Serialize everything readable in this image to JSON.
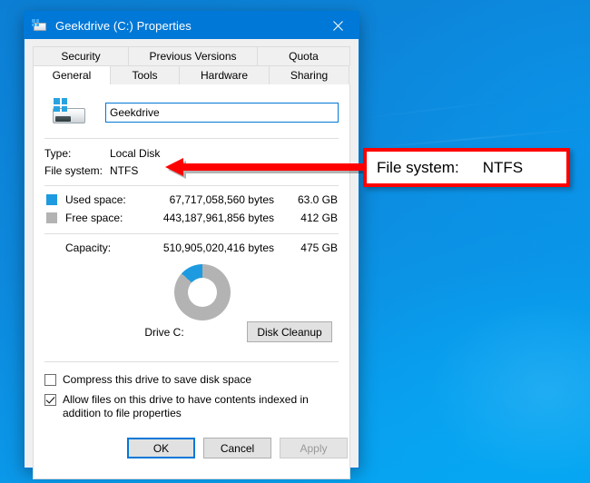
{
  "window": {
    "title": "Geekdrive (C:) Properties",
    "title_icon": "drive-icon",
    "close_label": "✕"
  },
  "tabs": {
    "row1": [
      {
        "label": "Security",
        "active": false
      },
      {
        "label": "Previous Versions",
        "active": false
      },
      {
        "label": "Quota",
        "active": false
      }
    ],
    "row2": [
      {
        "label": "General",
        "active": true
      },
      {
        "label": "Tools",
        "active": false
      },
      {
        "label": "Hardware",
        "active": false
      },
      {
        "label": "Sharing",
        "active": false
      }
    ]
  },
  "general": {
    "volume_name": "Geekdrive",
    "volume_name_placeholder": "",
    "info": [
      {
        "label": "Type:",
        "value": "Local Disk"
      },
      {
        "label": "File system:",
        "value": "NTFS"
      }
    ],
    "space": [
      {
        "swatch": "used",
        "label": "Used space:",
        "bytes": "67,717,058,560 bytes",
        "gb": "63.0 GB"
      },
      {
        "swatch": "free",
        "label": "Free space:",
        "bytes": "443,187,961,856 bytes",
        "gb": "412 GB"
      }
    ],
    "capacity": {
      "label": "Capacity:",
      "bytes": "510,905,020,416 bytes",
      "gb": "475 GB"
    },
    "drive_label": "Drive C:",
    "cleanup_button": "Disk Cleanup",
    "options": [
      {
        "label": "Compress this drive to save disk space",
        "checked": false
      },
      {
        "label": "Allow files on this drive to have contents indexed in addition to file properties",
        "checked": true
      }
    ]
  },
  "chart_data": {
    "type": "pie",
    "title": "Drive C:",
    "categories": [
      "Used space",
      "Free space"
    ],
    "values": [
      63.0,
      412
    ],
    "percent": [
      13.3,
      86.7
    ],
    "colors": [
      "#1e9be0",
      "#b3b3b3"
    ],
    "units": "GB",
    "donut": true,
    "legend": "left-swatches",
    "start_angle_deg": 0,
    "direction": "counter-clockwise"
  },
  "buttons": {
    "ok": "OK",
    "cancel": "Cancel",
    "apply": "Apply",
    "apply_disabled": true
  },
  "annotation": {
    "label": "File system:",
    "value": "NTFS",
    "box_color": "#ff0000",
    "arrow_color": "#ff0000"
  },
  "colors": {
    "accent": "#0078d7",
    "used_space": "#1e9be0",
    "free_space": "#b3b3b3",
    "desktop": "#0a8bdc"
  }
}
